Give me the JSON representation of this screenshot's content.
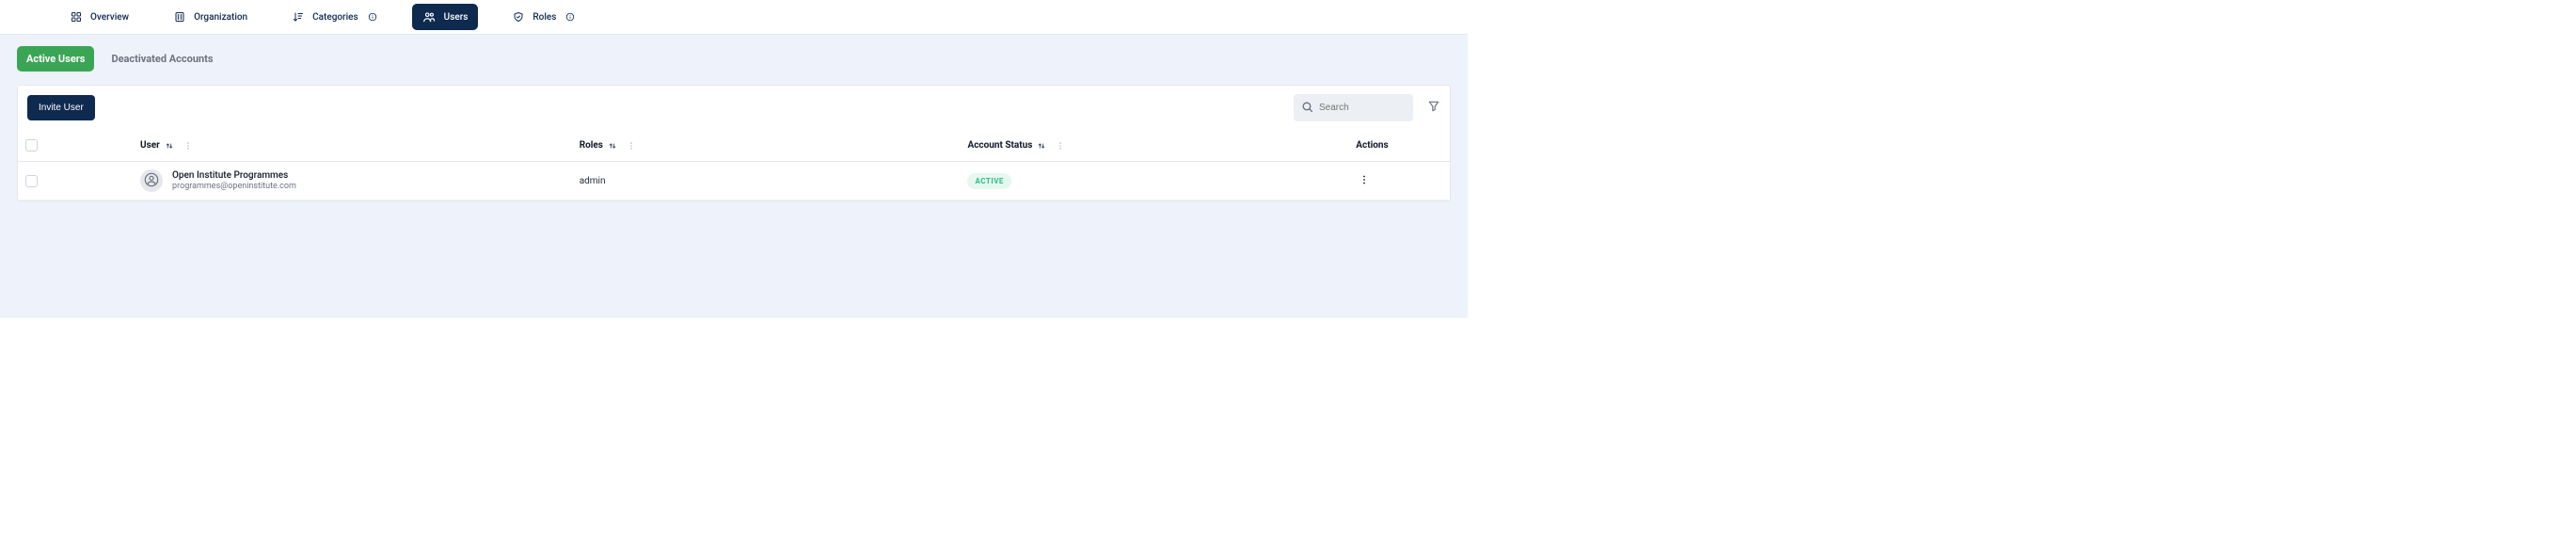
{
  "nav": {
    "overview": {
      "label": "Overview"
    },
    "organization": {
      "label": "Organization"
    },
    "categories": {
      "label": "Categories"
    },
    "users": {
      "label": "Users"
    },
    "roles": {
      "label": "Roles"
    }
  },
  "tabs": {
    "active_users": "Active Users",
    "deactivated": "Deactivated Accounts"
  },
  "toolbar": {
    "invite_label": "Invite User",
    "search_placeholder": "Search"
  },
  "table": {
    "headers": {
      "user": "User",
      "roles": "Roles",
      "status": "Account Status",
      "actions": "Actions"
    },
    "rows": [
      {
        "name": "Open Institute Programmes",
        "email": "programmes@openinstitute.com",
        "role": "admin",
        "status": "ACTIVE"
      }
    ]
  },
  "icons": {
    "overview": "grid-icon",
    "organization": "building-icon",
    "categories": "sort-desc-icon",
    "users": "users-group-icon",
    "roles": "shield-check-icon",
    "info": "info-circle-icon",
    "search": "search-icon",
    "filter": "funnel-icon",
    "sort": "sort-arrows-icon",
    "col_menu": "vertical-dots-icon",
    "avatar": "user-circle-icon",
    "row_actions": "vertical-dots-icon"
  },
  "colors": {
    "brand_dark": "#0f2a4f",
    "green": "#3aa655",
    "status_green": "#2bbf88",
    "page_bg": "#eef3fb"
  }
}
